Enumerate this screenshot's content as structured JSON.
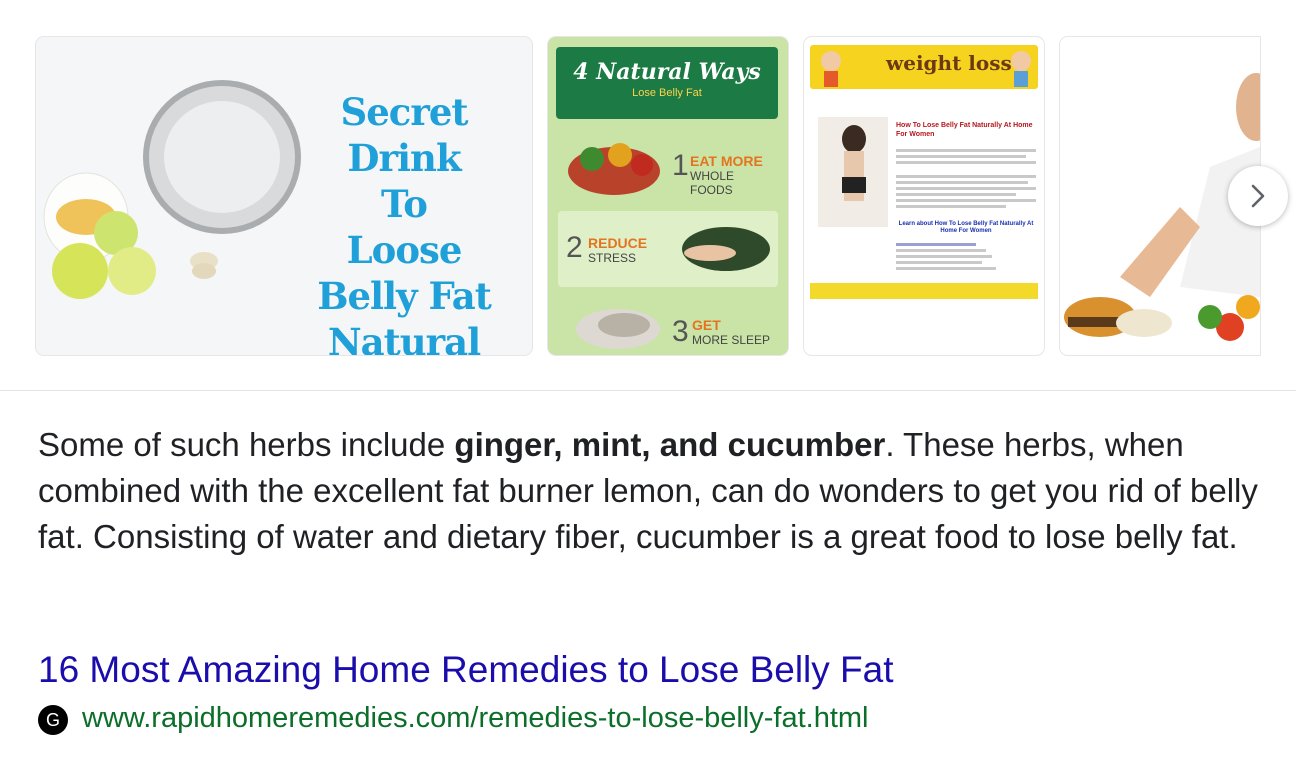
{
  "carousel": {
    "images": [
      {
        "headline": "Secret Drink\nTo\nLoose\nBelly Fat\nNatural Way"
      },
      {
        "banner_title": "4 Natural Ways",
        "banner_subtitle": "Lose Belly Fat",
        "steps": [
          {
            "num": "1",
            "title": "EAT MORE",
            "sub": "WHOLE FOODS"
          },
          {
            "num": "2",
            "title": "REDUCE",
            "sub": "STRESS"
          },
          {
            "num": "3",
            "title": "GET",
            "sub": "MORE SLEEP"
          }
        ]
      },
      {
        "header": "weight loss",
        "article_title": "How To Lose Belly Fat Naturally At Home For Women",
        "link_text": "Learn about How To Lose Belly Fat Naturally At Home For Women"
      },
      {}
    ],
    "next_icon": "chevron-right-icon"
  },
  "snippet": {
    "before": "Some of such herbs include ",
    "bold": "ginger, mint, and cucumber",
    "after": ". These herbs, when combined with the excellent fat burner lemon, can do wonders to get you rid of belly fat. Consisting of water and dietary fiber, cucumber is a great food to lose belly fat."
  },
  "result": {
    "title": "16 Most Amazing Home Remedies to Lose Belly Fat",
    "favicon_letter": "G",
    "url": "www.rapidhomeremedies.com/remedies-to-lose-belly-fat.html"
  },
  "colors": {
    "link": "#1a0dab",
    "url": "#0b6e29",
    "text": "#202124"
  }
}
